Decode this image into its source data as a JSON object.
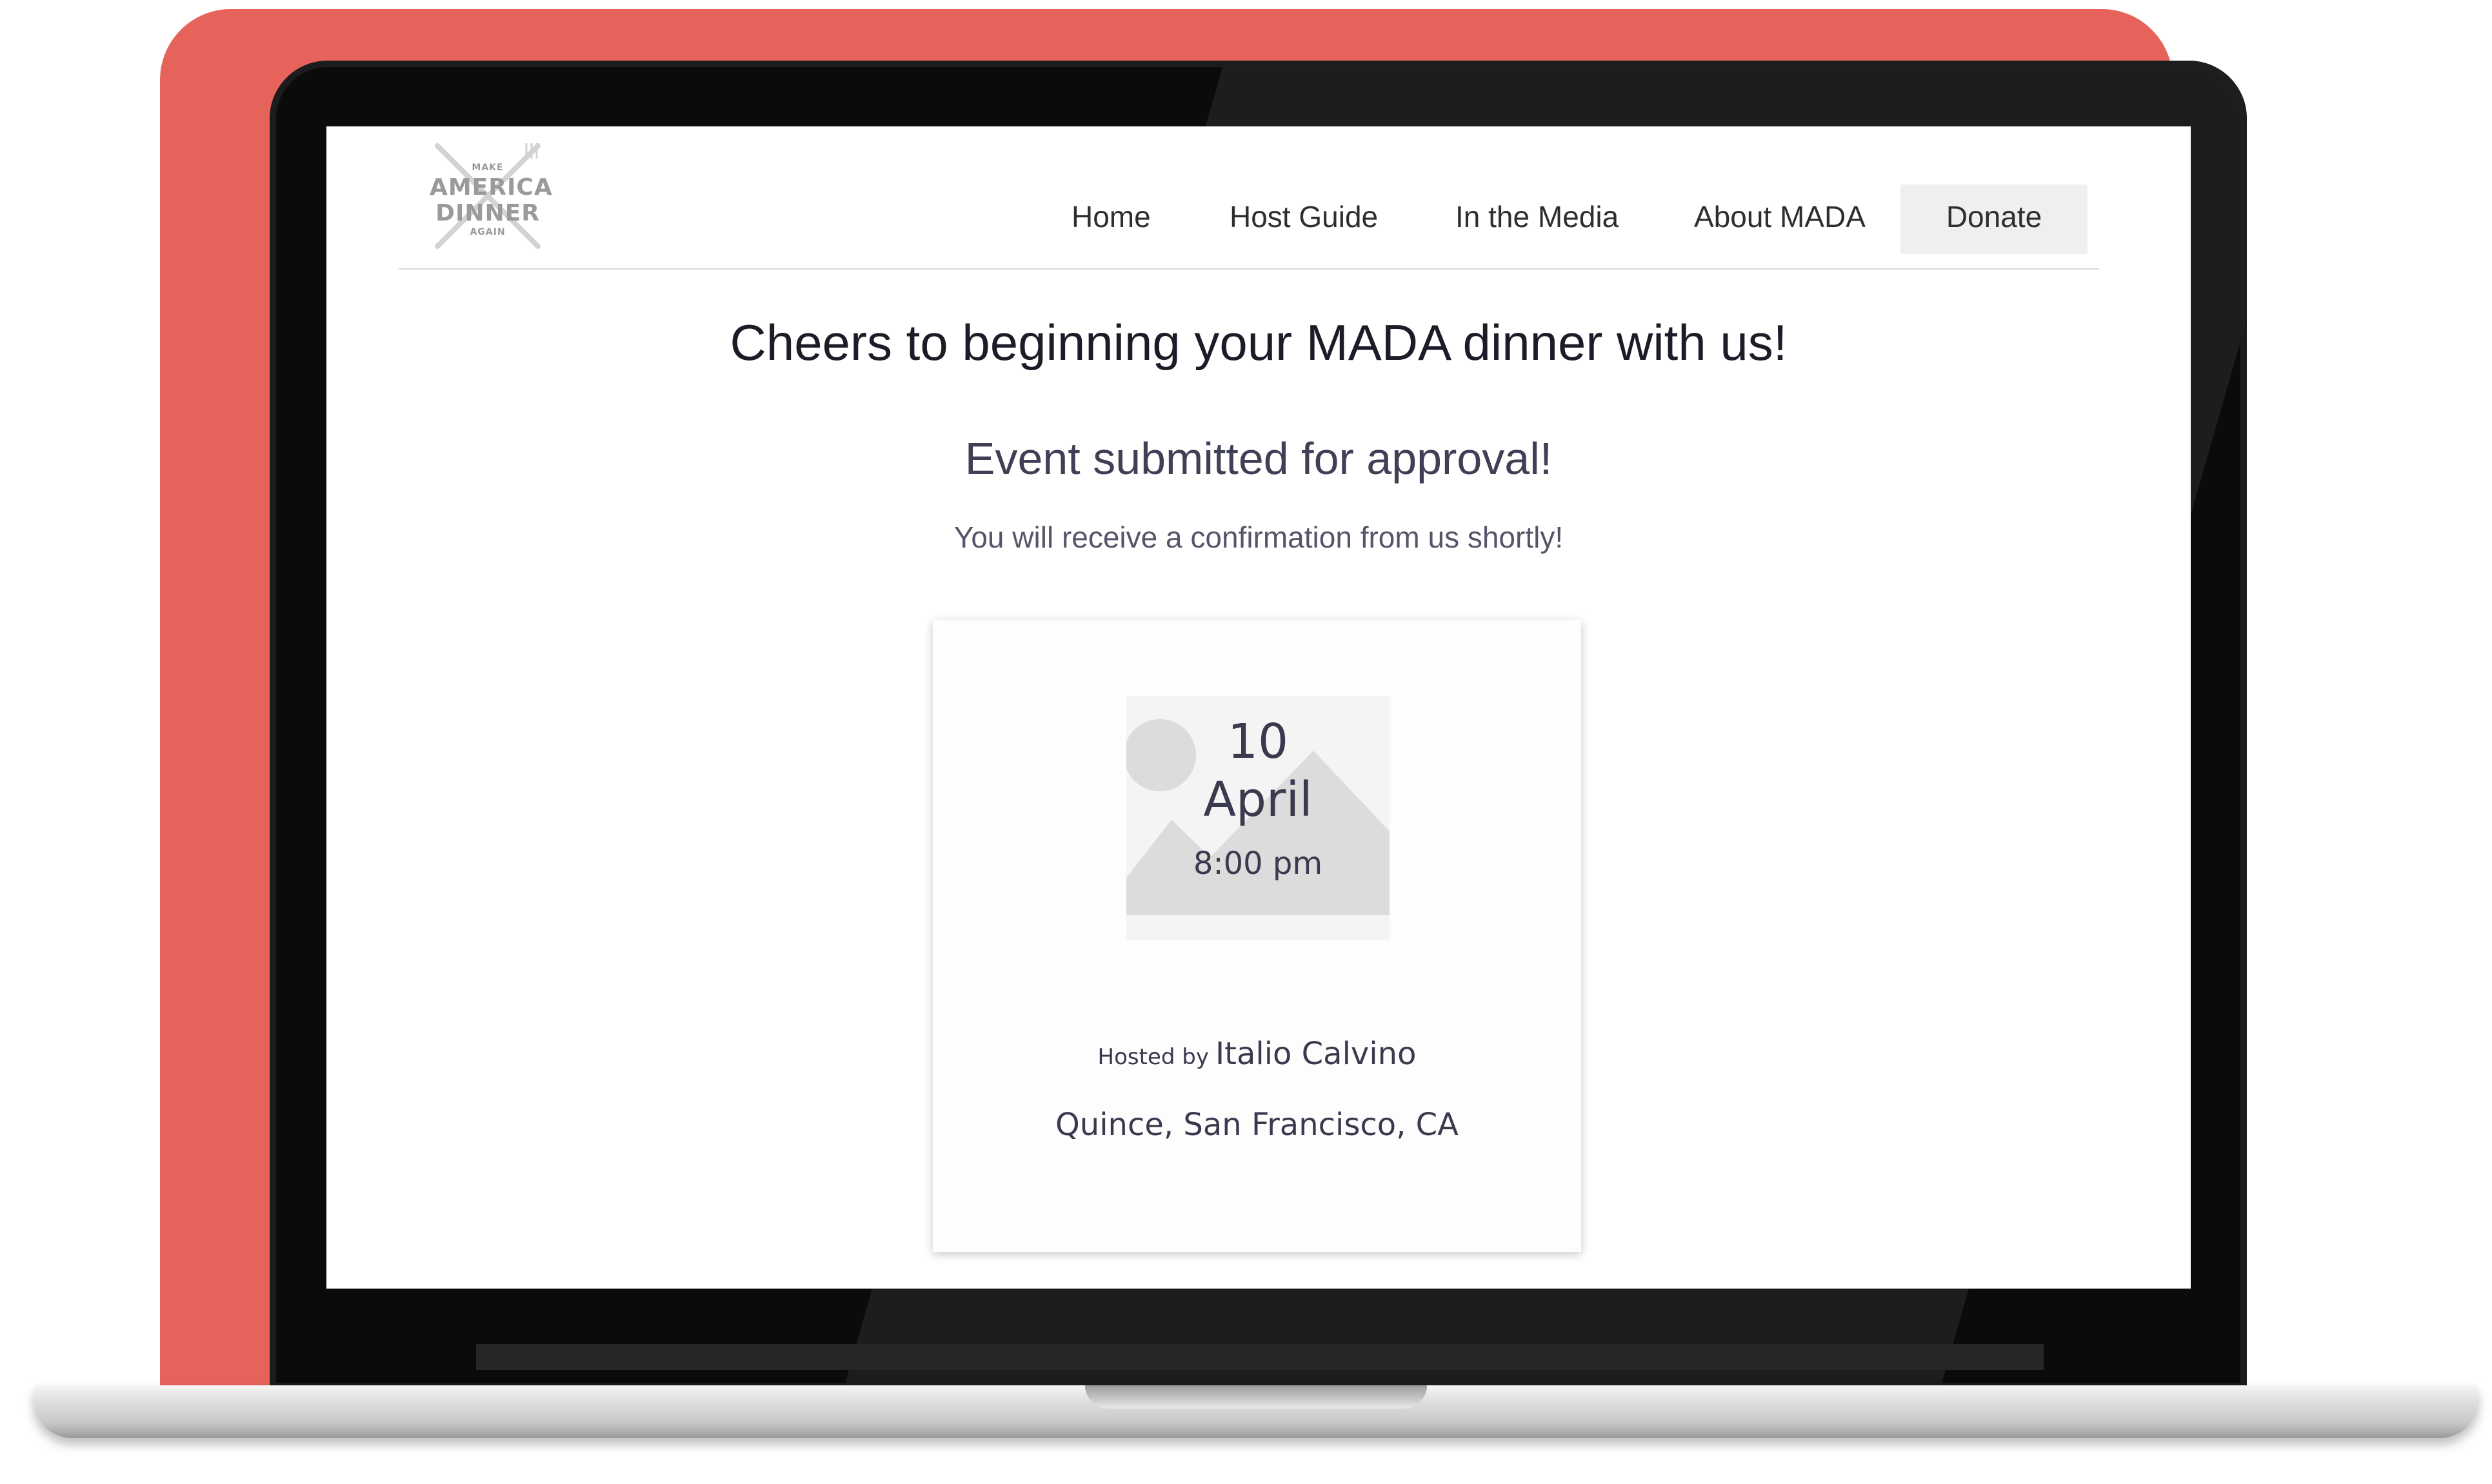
{
  "colors": {
    "backdrop": "#e6635c",
    "bezel": "#0b0b0b",
    "donate_bg": "#efeff1",
    "text_dark": "#1c1c28",
    "text_muted": "#3f3f55"
  },
  "logo": {
    "line1": "MAKE",
    "line2": "AMERICA",
    "line3": "DINNER",
    "line4": "AGAIN",
    "icon": "crossed-fork-knife-icon"
  },
  "nav": {
    "items": [
      {
        "label": "Home"
      },
      {
        "label": "Host Guide"
      },
      {
        "label": "In the Media"
      },
      {
        "label": "About MADA"
      }
    ],
    "donate_label": "Donate"
  },
  "main": {
    "headline": "Cheers to beginning your MADA dinner with us!",
    "subhead": "Event submitted for approval!",
    "note": "You will receive a confirmation from us shortly!"
  },
  "event": {
    "image_icon": "image-placeholder-icon",
    "day": "10",
    "month": "April",
    "time": "8:00 pm",
    "hosted_by_label": "Hosted by",
    "host_name": "Italio Calvino",
    "location": "Quince, San Francisco, CA"
  }
}
